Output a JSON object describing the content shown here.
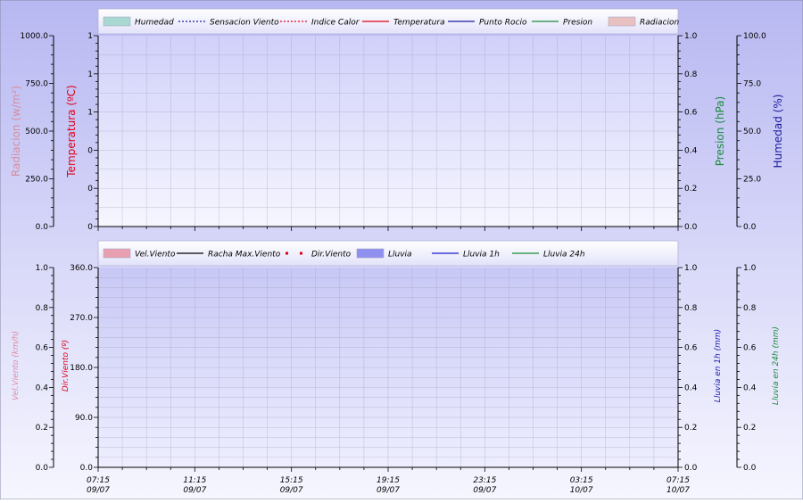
{
  "colors": {
    "bg_top": "#b8b8f2",
    "bg_bottom": "#f6f6ff",
    "plot_top_start": "#d0d0fa",
    "plot_top_end": "#f6f6ff",
    "plot_bottom_start": "#c8c8f6",
    "plot_bottom_end": "#eeeeff",
    "grid": "#9a9ab8",
    "axis": "#000000",
    "radiacion": "#d88c9c",
    "temperatura": "#e0001a",
    "presion": "#1a8c3a",
    "humedad": "#1a1aa0",
    "vel_viento": "#e08aa0",
    "dir_viento": "#e0001a",
    "lluvia_1h": "#2020b0",
    "lluvia_24h": "#1a8c3a"
  },
  "chart_data": [
    {
      "type": "line",
      "title": "",
      "legend_position": "top",
      "legend": [
        {
          "label": "Humedad",
          "style": "area",
          "color": "#a8d8d0"
        },
        {
          "label": "Sensacion Viento",
          "style": "dotted",
          "color": "#1a1aa0"
        },
        {
          "label": "Indice Calor",
          "style": "dotted",
          "color": "#e0001a"
        },
        {
          "label": "Temperatura",
          "style": "solid",
          "color": "#e0001a"
        },
        {
          "label": "Punto Rocio",
          "style": "solid",
          "color": "#1a1aa0"
        },
        {
          "label": "Presion",
          "style": "solid",
          "color": "#1a8c3a"
        },
        {
          "label": "Radiacion",
          "style": "area",
          "color": "#e8c0c0"
        }
      ],
      "axes": {
        "radiacion": {
          "label": "Radiacion (w/m²)",
          "ticks": [
            "1000.0",
            "750.0",
            "500.0",
            "250.0",
            "0.0"
          ]
        },
        "temperatura": {
          "label": "Temperatura (ºC)",
          "ticks": [
            "1",
            "1",
            "1",
            "0",
            "0",
            "0"
          ]
        },
        "presion": {
          "label": "Presion (hPa)",
          "ticks": [
            "1.0",
            "0.8",
            "0.6",
            "0.4",
            "0.2",
            "0.0"
          ]
        },
        "humedad": {
          "label": "Humedad (%)",
          "ticks": [
            "100.0",
            "75.0",
            "50.0",
            "25.0",
            "0.0"
          ]
        }
      },
      "series": [],
      "grid": true
    },
    {
      "type": "line",
      "title": "",
      "legend_position": "top",
      "legend": [
        {
          "label": "Vel.Viento",
          "style": "area",
          "color": "#e8a0b0"
        },
        {
          "label": "Racha Max.Viento",
          "style": "solid",
          "color": "#000000"
        },
        {
          "label": "Dir.Viento",
          "style": "dots",
          "color": "#e0001a"
        },
        {
          "label": "Lluvia",
          "style": "area",
          "color": "#9090f0"
        },
        {
          "label": "Lluvia 1h",
          "style": "solid",
          "color": "#1a1ad0"
        },
        {
          "label": "Lluvia 24h",
          "style": "solid",
          "color": "#1a8c3a"
        }
      ],
      "axes": {
        "vel_viento": {
          "label": "Vel.Viento (km/h)",
          "ticks": [
            "1.0",
            "0.8",
            "0.6",
            "0.4",
            "0.2",
            "0.0"
          ]
        },
        "dir_viento": {
          "label": "Dir.Viento (º)",
          "ticks": [
            "360.0",
            "270.0",
            "180.0",
            "90.0",
            "0.0"
          ]
        },
        "lluvia_1h": {
          "label": "Lluvia en 1h (mm)",
          "ticks": [
            "1.0",
            "0.8",
            "0.6",
            "0.4",
            "0.2",
            "0.0"
          ]
        },
        "lluvia_24h": {
          "label": "Lluvia en 24h (mm)",
          "ticks": [
            "1.0",
            "0.8",
            "0.6",
            "0.4",
            "0.2",
            "0.0"
          ]
        }
      },
      "x_ticks": [
        {
          "time": "07:15",
          "date": "09/07"
        },
        {
          "time": "11:15",
          "date": "09/07"
        },
        {
          "time": "15:15",
          "date": "09/07"
        },
        {
          "time": "19:15",
          "date": "09/07"
        },
        {
          "time": "23:15",
          "date": "09/07"
        },
        {
          "time": "03:15",
          "date": "10/07"
        },
        {
          "time": "07:15",
          "date": "10/07"
        }
      ],
      "series": [],
      "grid": true
    }
  ]
}
